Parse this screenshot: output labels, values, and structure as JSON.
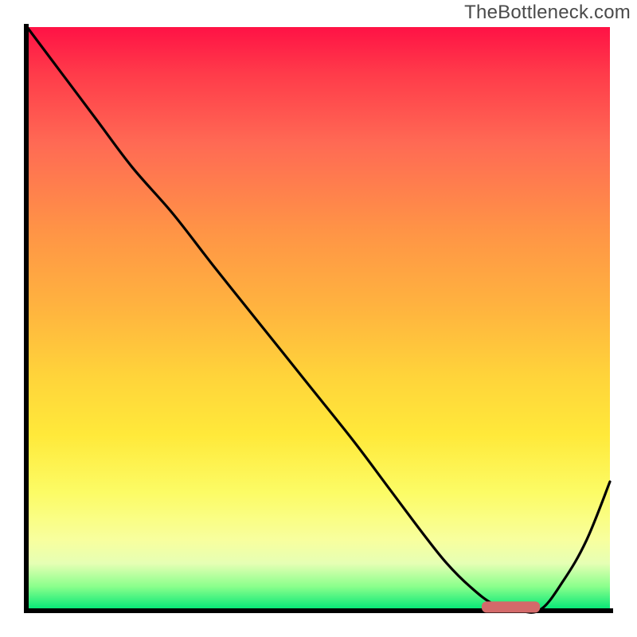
{
  "watermark": "TheBottleneck.com",
  "colors": {
    "axis": "#000000",
    "curve": "#000000",
    "marker": "#d46a6a",
    "gradient_stops": [
      "#ff1245",
      "#ff3b4a",
      "#ff6a54",
      "#ff9446",
      "#ffb33f",
      "#ffd43a",
      "#ffe93a",
      "#fcfc66",
      "#f8ff9e",
      "#e6ffb4",
      "#8aff8c",
      "#00e676"
    ]
  },
  "chart_data": {
    "type": "line",
    "title": "",
    "xlabel": "",
    "ylabel": "",
    "xlim": [
      0,
      100
    ],
    "ylim": [
      0,
      100
    ],
    "x": [
      0,
      6,
      12,
      18,
      25,
      32,
      40,
      48,
      56,
      62,
      68,
      72,
      76,
      80,
      84,
      88,
      92,
      96,
      100
    ],
    "values": [
      100,
      92,
      84,
      76,
      68,
      59,
      49,
      39,
      29,
      21,
      13,
      8,
      4,
      1,
      0,
      0,
      5,
      12,
      22
    ],
    "annotations": [
      {
        "kind": "range-marker",
        "x_start": 78,
        "x_end": 88,
        "y": 0.5
      }
    ]
  }
}
